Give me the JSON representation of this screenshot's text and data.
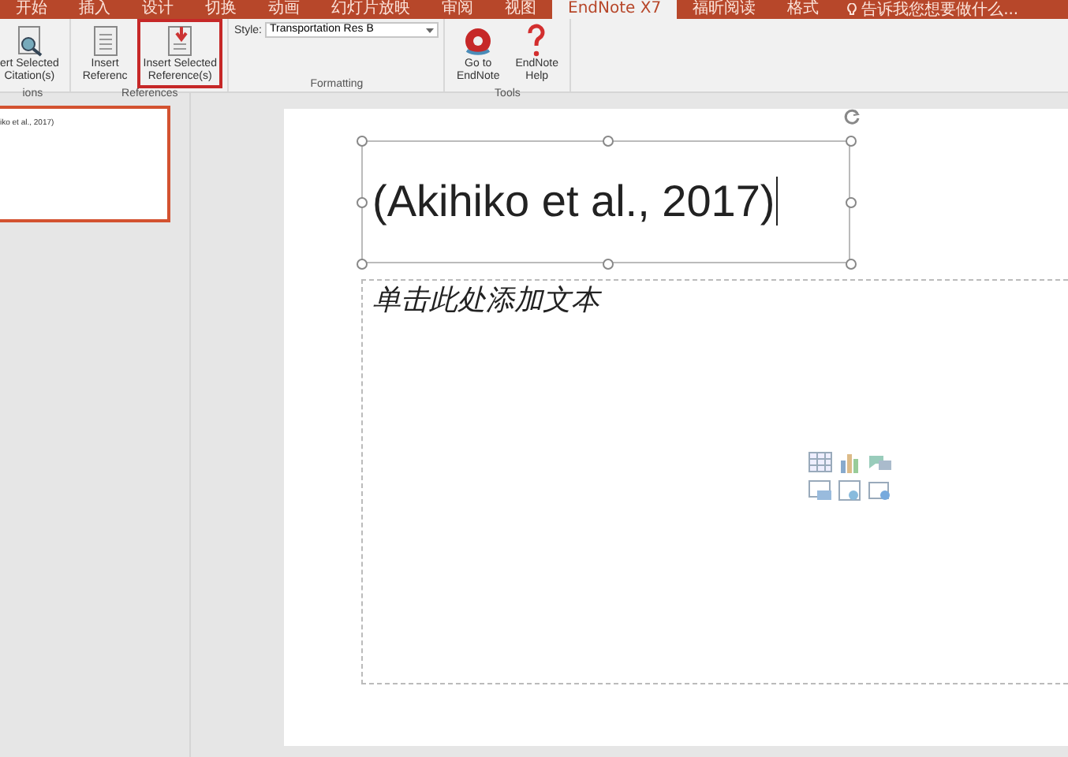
{
  "ribbon_tabs": [
    {
      "label": "开始",
      "selected": false
    },
    {
      "label": "插入",
      "selected": false
    },
    {
      "label": "设计",
      "selected": false
    },
    {
      "label": "切换",
      "selected": false
    },
    {
      "label": "动画",
      "selected": false
    },
    {
      "label": "幻灯片放映",
      "selected": false
    },
    {
      "label": "审阅",
      "selected": false
    },
    {
      "label": "视图",
      "selected": false
    },
    {
      "label": "EndNote X7",
      "selected": true
    },
    {
      "label": "福昕阅读",
      "selected": false
    },
    {
      "label": "格式",
      "selected": false
    }
  ],
  "tell_me": {
    "placeholder": "告诉我您想要做什么..."
  },
  "ribbon_groups": [
    {
      "label": "ions",
      "buttons": [
        {
          "kind": "citation",
          "lines": [
            "ert Selected",
            "Citation(s)"
          ],
          "highlighted": false
        }
      ]
    },
    {
      "label": "References",
      "buttons": [
        {
          "kind": "reference",
          "lines": [
            "Insert",
            "Referenc"
          ],
          "highlighted": false
        },
        {
          "kind": "selected_reference",
          "lines": [
            "Insert Selected",
            "Reference(s)"
          ],
          "highlighted": true
        }
      ]
    },
    {
      "label": "Formatting",
      "style": {
        "label": "Style:",
        "value": "Transportation Res B"
      }
    },
    {
      "label": "Tools",
      "buttons": [
        {
          "kind": "goto",
          "lines": [
            "Go to",
            "EndNote"
          ],
          "highlighted": false
        },
        {
          "kind": "help",
          "lines": [
            "EndNote",
            "Help"
          ],
          "highlighted": false
        }
      ]
    }
  ],
  "thumbnails": [
    {
      "text": "iko et al., 2017)",
      "selected": true
    }
  ],
  "slide": {
    "title": "(Akihiko et al., 2017)",
    "body_placeholder": "单击此处添加文本"
  }
}
